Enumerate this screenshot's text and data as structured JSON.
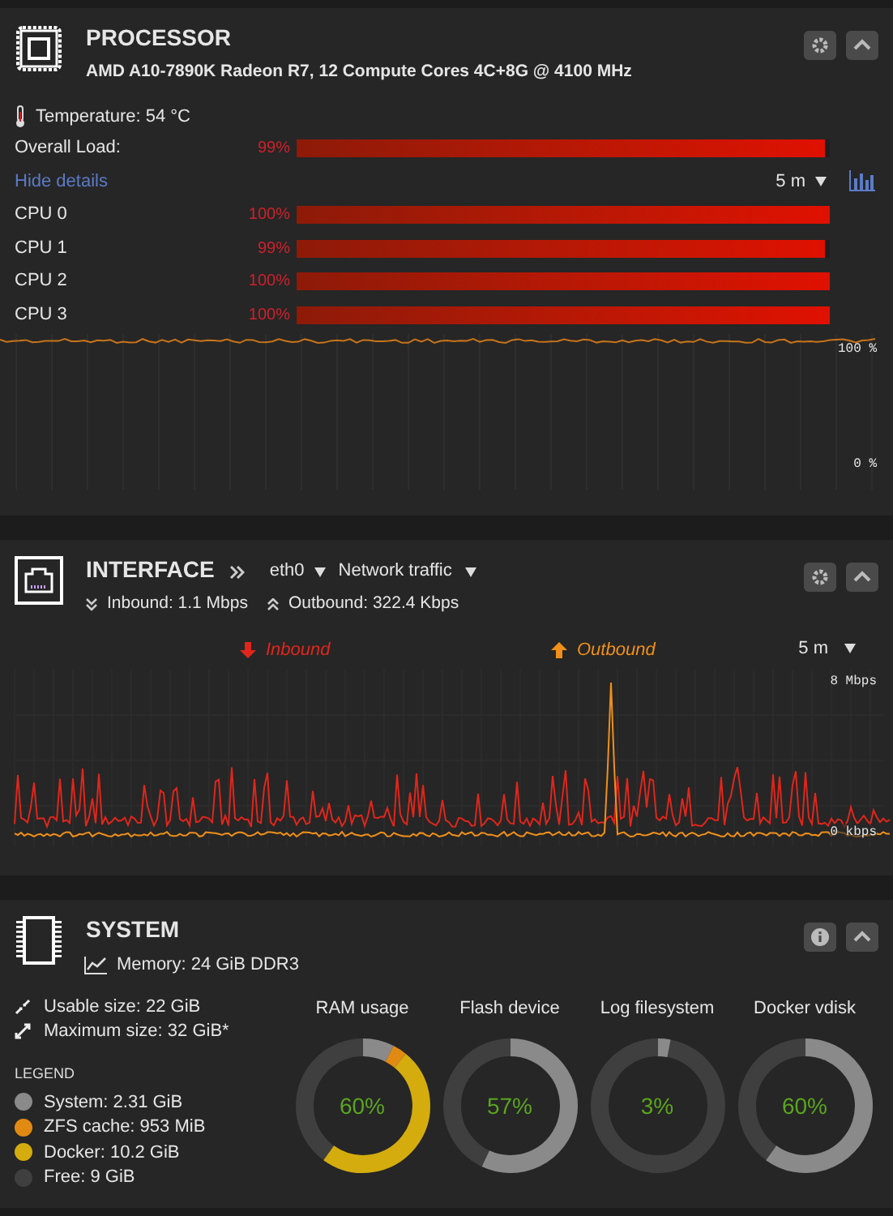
{
  "processor": {
    "title": "PROCESSOR",
    "model": "AMD A10-7890K Radeon R7, 12 Compute Cores 4C+8G @ 4100 MHz",
    "temperature": "Temperature: 54 °C",
    "overall": {
      "label": "Overall Load:",
      "reading": "99%",
      "level": 0.99
    },
    "details_link": "Hide details",
    "range": "5 m",
    "cores": [
      {
        "label": "CPU 0",
        "reading": "100%",
        "level": 1
      },
      {
        "label": "CPU 1",
        "reading": "99%",
        "level": 0.99
      },
      {
        "label": "CPU 2",
        "reading": "100%",
        "level": 1
      },
      {
        "label": "CPU 3",
        "reading": "100%",
        "level": 1
      }
    ],
    "graph_labels": [
      "100 %",
      "0 %"
    ]
  },
  "interface": {
    "title": "INTERFACE",
    "port": "eth0",
    "mode": "Network traffic",
    "inbound": "Inbound: 1.1 Mbps",
    "outbound": "Outbound: 322.4 Kbps",
    "legend": [
      {
        "label": "Inbound",
        "color": "#e0261b"
      },
      {
        "label": "Outbound",
        "color": "#f0901a"
      }
    ],
    "range": "5 m",
    "graph_labels": [
      "8 Mbps",
      "0 kbps"
    ]
  },
  "system": {
    "title": "SYSTEM",
    "memory": "Memory: 24 GiB DDR3",
    "usable": "Usable size: 22 GiB",
    "maximum": "Maximum size: 32 GiB*",
    "legend_title": "LEGEND",
    "legend": [
      {
        "label": "System: 2.31 GiB",
        "color": "#8a8a8a"
      },
      {
        "label": "ZFS cache: 953 MiB",
        "color": "#e08a14"
      },
      {
        "label": "Docker: 10.2 GiB",
        "color": "#d4ac0d"
      },
      {
        "label": "Free: 9 GiB",
        "color": "#3f3f3f"
      }
    ],
    "gauges": [
      {
        "label": "RAM usage",
        "reading": "60%",
        "kind": "memory"
      },
      {
        "label": "Flash device",
        "reading": "57%",
        "kind": "disk"
      },
      {
        "label": "Log filesystem",
        "reading": "3%",
        "kind": "disk"
      },
      {
        "label": "Docker vdisk",
        "reading": "60%",
        "kind": "disk"
      }
    ]
  }
}
